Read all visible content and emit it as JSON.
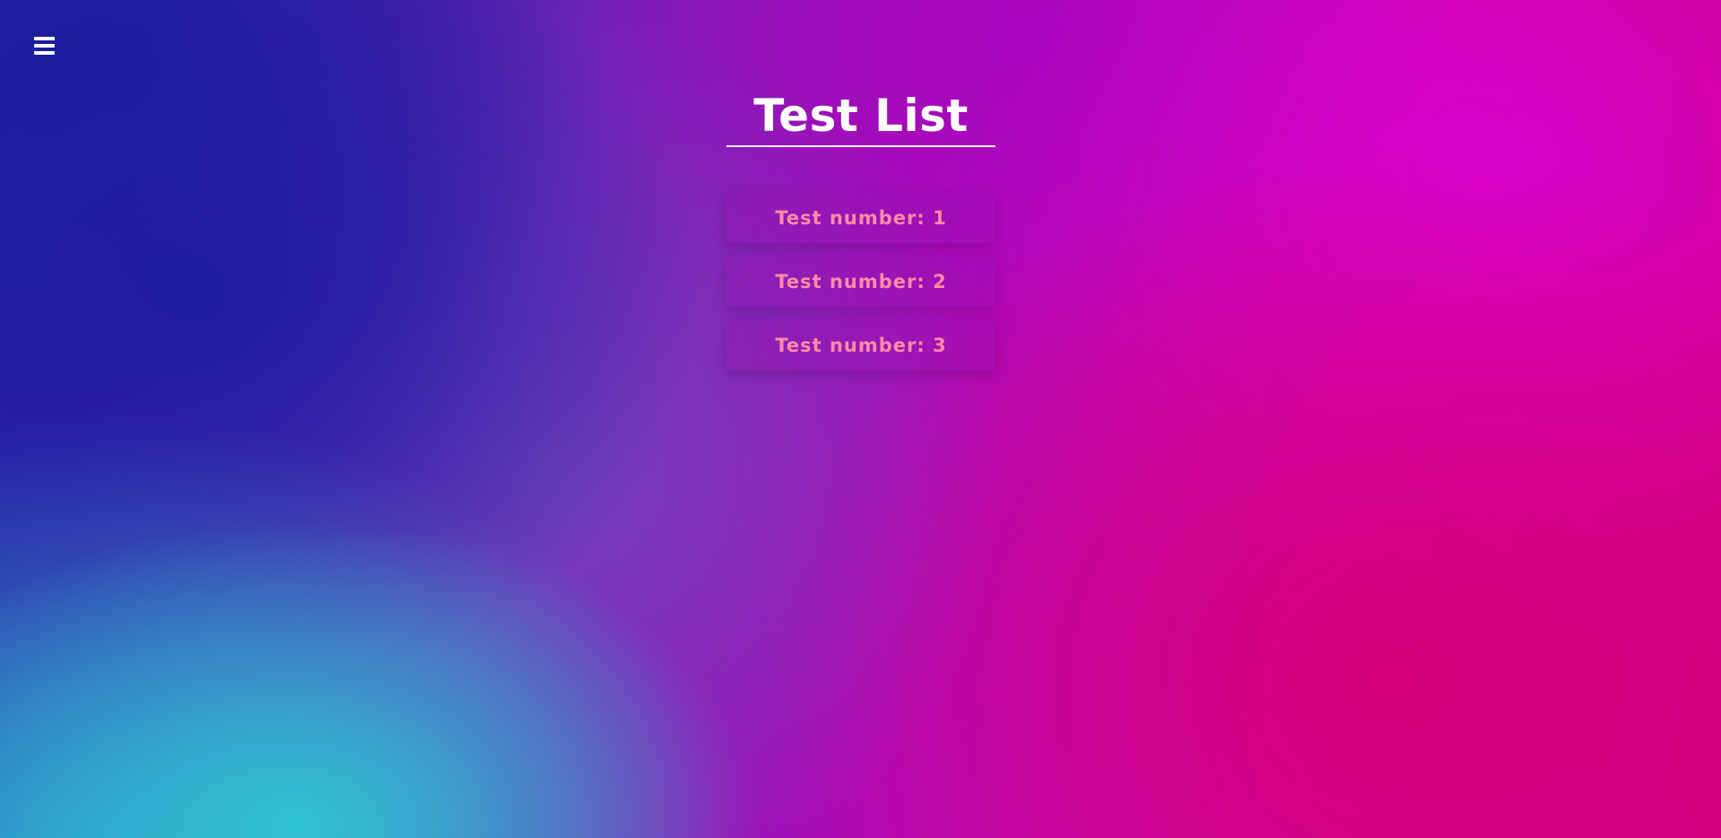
{
  "nav": {
    "menu_icon": "hamburger-menu-icon"
  },
  "page": {
    "title": "Test List"
  },
  "tests": [
    {
      "label": "Test number: 1"
    },
    {
      "label": "Test number: 2"
    },
    {
      "label": "Test number: 3"
    }
  ],
  "colors": {
    "title_text": "#ffffff",
    "item_text": "#ff8aa8",
    "background_blue": "#1c1e9b",
    "background_cyan": "#30c8d2",
    "background_magenta": "#d800ce",
    "background_pink": "#d60078"
  }
}
